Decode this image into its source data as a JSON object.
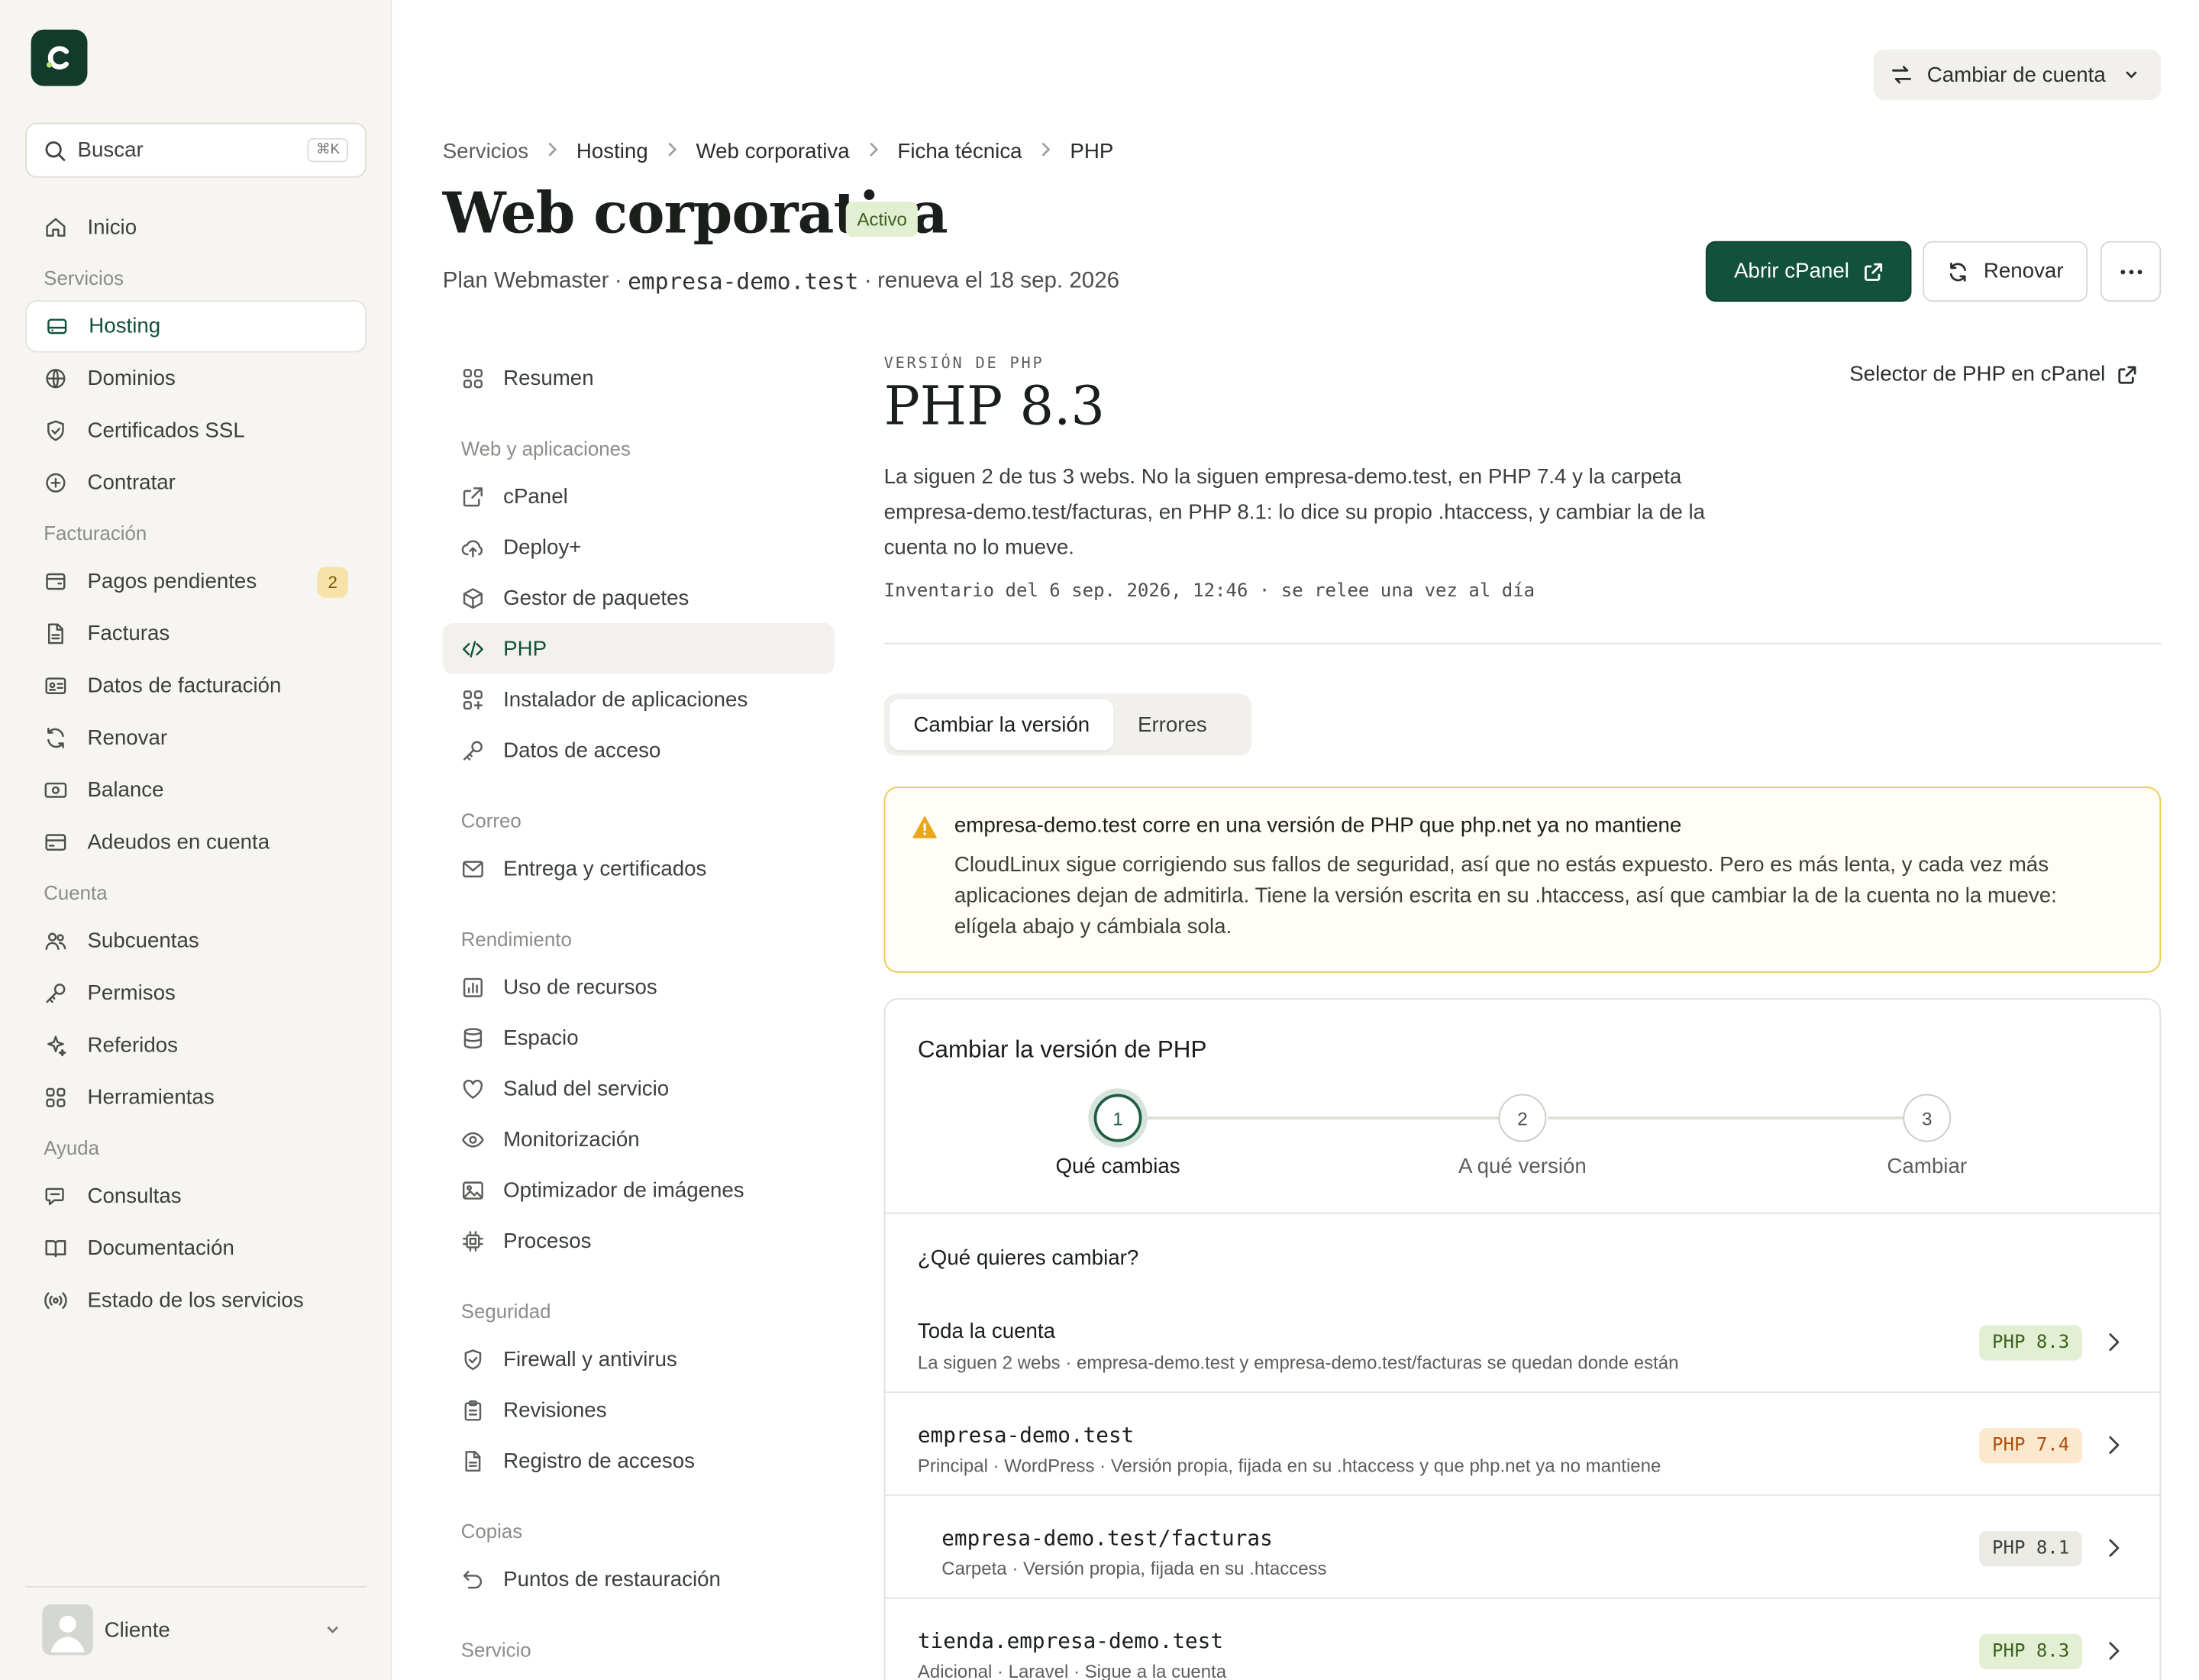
{
  "sidebar": {
    "search": {
      "label": "Buscar",
      "shortcut": "⌘K"
    },
    "items": [
      {
        "type": "item",
        "label": "Inicio",
        "icon": "home-icon"
      },
      {
        "type": "group",
        "label": "Servicios"
      },
      {
        "type": "item",
        "label": "Hosting",
        "icon": "server-icon",
        "active": true
      },
      {
        "type": "item",
        "label": "Dominios",
        "icon": "globe-icon"
      },
      {
        "type": "item",
        "label": "Certificados SSL",
        "icon": "shield-icon"
      },
      {
        "type": "item",
        "label": "Contratar",
        "icon": "plus-circle-icon"
      },
      {
        "type": "group",
        "label": "Facturación"
      },
      {
        "type": "item",
        "label": "Pagos pendientes",
        "icon": "wallet-icon",
        "badge": "2"
      },
      {
        "type": "item",
        "label": "Facturas",
        "icon": "file-icon"
      },
      {
        "type": "item",
        "label": "Datos de facturación",
        "icon": "id-card-icon"
      },
      {
        "type": "item",
        "label": "Renovar",
        "icon": "refresh-icon"
      },
      {
        "type": "item",
        "label": "Balance",
        "icon": "banknote-icon"
      },
      {
        "type": "item",
        "label": "Adeudos en cuenta",
        "icon": "credit-card-icon"
      },
      {
        "type": "group",
        "label": "Cuenta"
      },
      {
        "type": "item",
        "label": "Subcuentas",
        "icon": "users-icon"
      },
      {
        "type": "item",
        "label": "Permisos",
        "icon": "key-icon"
      },
      {
        "type": "item",
        "label": "Referidos",
        "icon": "sparkles-icon"
      },
      {
        "type": "item",
        "label": "Herramientas",
        "icon": "grid-icon"
      },
      {
        "type": "group",
        "label": "Ayuda"
      },
      {
        "type": "item",
        "label": "Consultas",
        "icon": "chat-icon"
      },
      {
        "type": "item",
        "label": "Documentación",
        "icon": "book-icon"
      },
      {
        "type": "item",
        "label": "Estado de los servicios",
        "icon": "broadcast-icon"
      }
    ],
    "user": {
      "name": "Cliente"
    }
  },
  "header": {
    "account_switch": "Cambiar de cuenta",
    "breadcrumb": [
      "Servicios",
      "Hosting",
      "Web corporativa",
      "Ficha técnica",
      "PHP"
    ],
    "title": "Web corporativa",
    "status": "Activo",
    "plan": "Plan Webmaster",
    "domain": "empresa-demo.test",
    "renewal": "renueva el 18 sep. 2026",
    "open_cpanel": "Abrir cPanel",
    "renew": "Renovar"
  },
  "subnav": [
    {
      "type": "item",
      "label": "Resumen",
      "icon": "grid-icon"
    },
    {
      "type": "group",
      "label": "Web y aplicaciones"
    },
    {
      "type": "item",
      "label": "cPanel",
      "icon": "external-link-icon"
    },
    {
      "type": "item",
      "label": "Deploy+",
      "icon": "cloud-upload-icon"
    },
    {
      "type": "item",
      "label": "Gestor de paquetes",
      "icon": "package-icon"
    },
    {
      "type": "item",
      "label": "PHP",
      "icon": "code-icon",
      "active": true
    },
    {
      "type": "item",
      "label": "Instalador de aplicaciones",
      "icon": "grid-plus-icon"
    },
    {
      "type": "item",
      "label": "Datos de acceso",
      "icon": "key-icon"
    },
    {
      "type": "group",
      "label": "Correo"
    },
    {
      "type": "item",
      "label": "Entrega y certificados",
      "icon": "mail-icon"
    },
    {
      "type": "group",
      "label": "Rendimiento"
    },
    {
      "type": "item",
      "label": "Uso de recursos",
      "icon": "bar-chart-icon"
    },
    {
      "type": "item",
      "label": "Espacio",
      "icon": "database-icon"
    },
    {
      "type": "item",
      "label": "Salud del servicio",
      "icon": "heart-icon"
    },
    {
      "type": "item",
      "label": "Monitorización",
      "icon": "eye-icon"
    },
    {
      "type": "item",
      "label": "Optimizador de imágenes",
      "icon": "image-icon"
    },
    {
      "type": "item",
      "label": "Procesos",
      "icon": "cpu-icon"
    },
    {
      "type": "group",
      "label": "Seguridad"
    },
    {
      "type": "item",
      "label": "Firewall y antivirus",
      "icon": "shield-icon"
    },
    {
      "type": "item",
      "label": "Revisiones",
      "icon": "clipboard-icon"
    },
    {
      "type": "item",
      "label": "Registro de accesos",
      "icon": "file-icon"
    },
    {
      "type": "group",
      "label": "Copias"
    },
    {
      "type": "item",
      "label": "Puntos de restauración",
      "icon": "undo-icon"
    },
    {
      "type": "group",
      "label": "Servicio"
    }
  ],
  "content": {
    "eyebrow": "VERSIÓN DE PHP",
    "php_version": "PHP 8.3",
    "selector_link": "Selector de PHP en cPanel",
    "description": "La siguen 2 de tus 3 webs. No la siguen empresa-demo.test, en PHP 7.4 y la carpeta empresa-demo.test/facturas, en PHP 8.1: lo dice su propio .htaccess, y cambiar la de la cuenta no lo mueve.",
    "inventory": "Inventario del 6 sep. 2026, 12:46 · se relee una vez al día",
    "tabs": [
      "Cambiar la versión",
      "Errores"
    ],
    "alert": {
      "title": "empresa-demo.test corre en una versión de PHP que php.net ya no mantiene",
      "body": "CloudLinux sigue corrigiendo sus fallos de seguridad, así que no estás expuesto. Pero es más lenta, y cada vez más aplicaciones dejan de admitirla. Tiene la versión escrita en su .htaccess, así que cambiar la de la cuenta no la mueve: elígela abajo y cámbiala sola."
    },
    "card": {
      "title": "Cambiar la versión de PHP",
      "steps": [
        {
          "num": "1",
          "label": "Qué cambias"
        },
        {
          "num": "2",
          "label": "A qué versión"
        },
        {
          "num": "3",
          "label": "Cambiar"
        }
      ],
      "question": "¿Qué quieres cambiar?",
      "rows": [
        {
          "title": "Toda la cuenta",
          "sub": "La siguen 2 webs · empresa-demo.test y empresa-demo.test/facturas se quedan donde están",
          "php": "PHP 8.3",
          "status": "ok",
          "mono": false,
          "indent": false
        },
        {
          "title": "empresa-demo.test",
          "sub": "Principal · WordPress · Versión propia, fijada en su .htaccess y que php.net ya no mantiene",
          "php": "PHP 7.4",
          "status": "warn",
          "mono": true,
          "indent": false
        },
        {
          "title": "empresa-demo.test/facturas",
          "sub": "Carpeta · Versión propia, fijada en su .htaccess",
          "php": "PHP 8.1",
          "status": "neutral",
          "mono": true,
          "indent": true
        },
        {
          "title": "tienda.empresa-demo.test",
          "sub": "Adicional · Laravel · Sigue a la cuenta",
          "php": "PHP 8.3",
          "status": "ok",
          "mono": true,
          "indent": false
        }
      ]
    }
  },
  "colors": {
    "brand": "#12513b",
    "warning_border": "#e8cc52",
    "ok_pill": "#e3efd3",
    "warn_pill": "#fbe8cf"
  }
}
